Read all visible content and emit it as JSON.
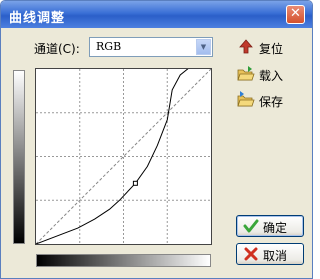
{
  "window": {
    "title": "曲线调整",
    "close_glyph": "✕"
  },
  "channel": {
    "label": "通道(C):",
    "value": "RGB"
  },
  "side_buttons": {
    "reset": "复位",
    "load": "载入",
    "save": "保存"
  },
  "buttons": {
    "ok": "确定",
    "cancel": "取消"
  },
  "curve": {
    "points": [
      [
        0,
        0
      ],
      [
        42,
        16
      ],
      [
        59,
        25
      ],
      [
        74,
        35
      ],
      [
        84,
        44
      ],
      [
        100,
        61
      ],
      [
        112,
        78
      ],
      [
        122,
        99
      ],
      [
        132,
        125
      ],
      [
        137,
        155
      ],
      [
        145,
        170
      ],
      [
        155,
        178
      ],
      [
        166,
        190
      ],
      [
        176,
        202
      ]
    ],
    "control_point": [
      100,
      61
    ],
    "grid_divisions": 4,
    "max": 176
  },
  "colors": {
    "title_bar": "#2b5fc9",
    "dialog_bg": "#ece9d8",
    "ok_icon": "#3aa63a",
    "cancel_icon": "#d03020"
  }
}
